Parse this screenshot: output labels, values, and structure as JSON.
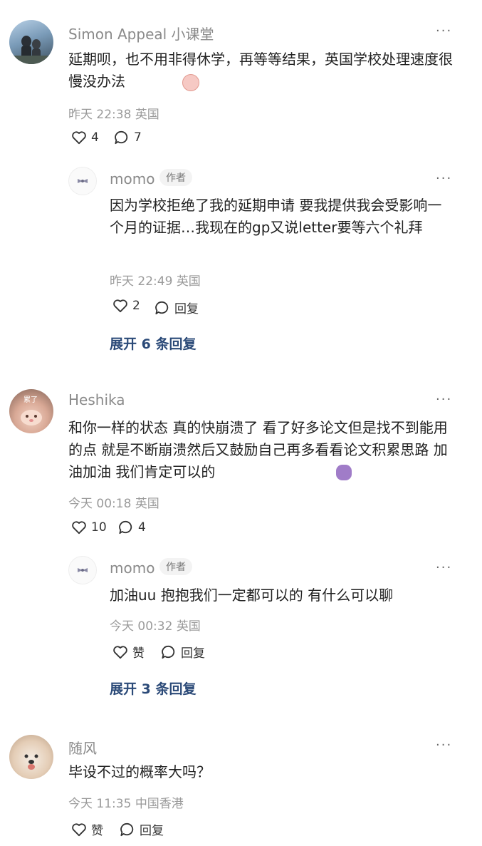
{
  "comments": [
    {
      "user": "Simon Appeal 小课堂",
      "text": "延期呗，也不用非得休学，再等等结果，英国学校处理速度很慢没办法",
      "time": "昨天 22:38",
      "location": "英国",
      "likes": "4",
      "replies_count": "7",
      "reply": {
        "user": "momo",
        "badge": "作者",
        "text": "因为学校拒绝了我的延期申请 要我提供我会受影响一个月的证据…我现在的gp又说letter要等六个礼拜",
        "time": "昨天 22:49",
        "location": "英国",
        "likes": "2",
        "reply_label": "回复"
      },
      "expand_label": "展开 6 条回复"
    },
    {
      "user": "Heshika",
      "avatar_text": "累了",
      "text": "和你一样的状态 真的快崩溃了 看了好多论文但是找不到能用的点 就是不断崩溃然后又鼓励自己再多看看论文积累思路 加油加油 我们肯定可以的",
      "time": "今天 00:18",
      "location": "英国",
      "likes": "10",
      "replies_count": "4",
      "reply": {
        "user": "momo",
        "badge": "作者",
        "text": "加油uu 抱抱我们一定都可以的 有什么可以聊",
        "time": "今天 00:32",
        "location": "英国",
        "likes": "赞",
        "reply_label": "回复"
      },
      "expand_label": "展开 3 条回复"
    },
    {
      "user": "随风",
      "text": "毕设不过的概率大吗？",
      "time": "今天 11:35",
      "location": "中国香港",
      "likes": "赞",
      "reply_label": "回复"
    }
  ],
  "more_glyph": "···",
  "icons": {
    "like": "heart-outline-icon",
    "comment": "comment-bubble-icon",
    "more": "more-dots-icon"
  },
  "colors": {
    "link": "#2b4a78",
    "meta": "#9a9a9a",
    "name": "#8a8a8a"
  }
}
